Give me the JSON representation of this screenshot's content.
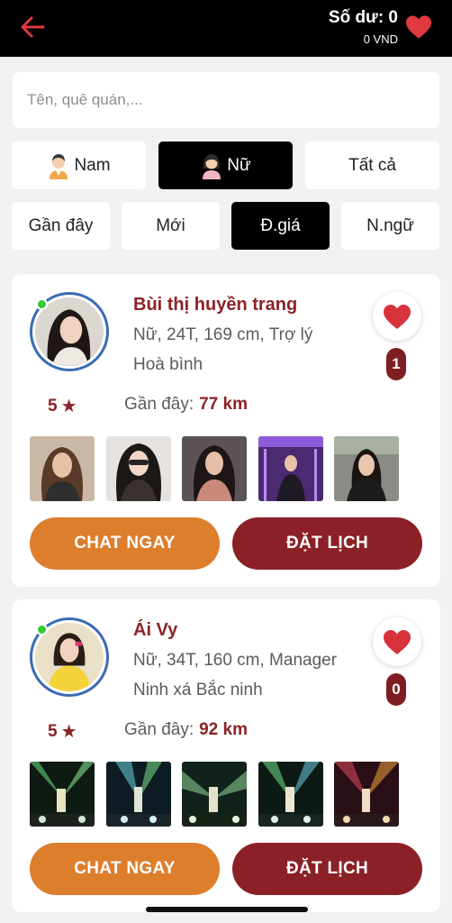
{
  "header": {
    "balance_title": "Số dư: 0",
    "balance_value": "0 VND",
    "back_icon": "arrow-left-icon",
    "heart_icon": "heart-icon"
  },
  "search": {
    "placeholder": "Tên, quê quán,..."
  },
  "gender_filters": [
    {
      "label": "Nam",
      "icon": "male-avatar-icon",
      "selected": false
    },
    {
      "label": "Nữ",
      "icon": "female-avatar-icon",
      "selected": true
    },
    {
      "label": "Tất cả",
      "selected": false
    }
  ],
  "sort_filters": [
    {
      "label": "Gần đây",
      "selected": false
    },
    {
      "label": "Mới",
      "selected": false
    },
    {
      "label": "Đ.giá",
      "selected": true
    },
    {
      "label": "N.ngữ",
      "selected": false
    }
  ],
  "profiles": [
    {
      "name": "Bùi thị huyền trang",
      "details": "Nữ, 24T, 169 cm, Trợ lý",
      "location": "Hoà bình",
      "rating": "5",
      "distance_label": "Gần đây:",
      "distance": "77 km",
      "likes": "1",
      "online": true,
      "chat_label": "CHAT NGAY",
      "book_label": "ĐẶT LỊCH"
    },
    {
      "name": "Ái Vy",
      "details": "Nữ, 34T, 160 cm, Manager",
      "location": "Ninh xá Bắc ninh",
      "rating": "5",
      "distance_label": "Gần đây:",
      "distance": "92 km",
      "likes": "0",
      "online": true,
      "chat_label": "CHAT NGAY",
      "book_label": "ĐẶT LỊCH"
    }
  ],
  "colors": {
    "accent_dark_red": "#8b2126",
    "accent_orange": "#dd7e2d",
    "heart_red": "#d8323a",
    "online_green": "#35c934"
  }
}
